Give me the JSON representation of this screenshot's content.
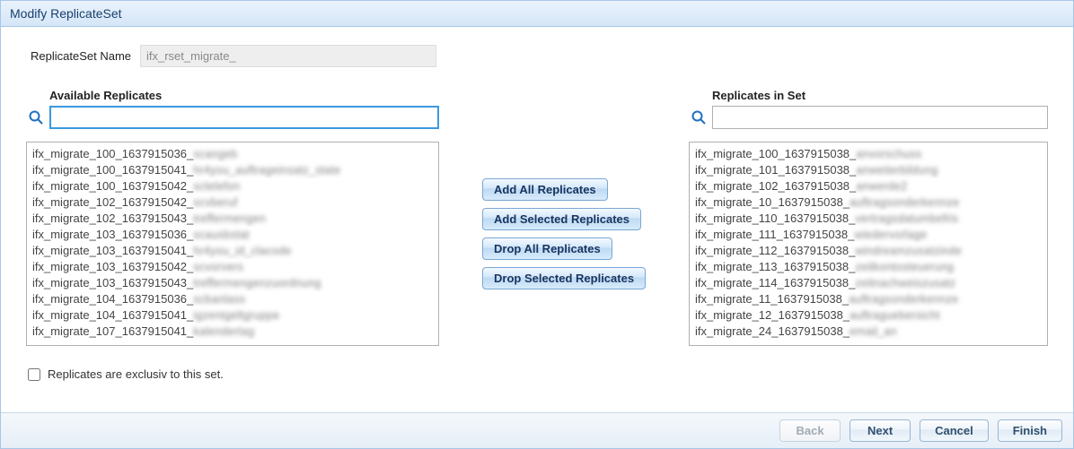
{
  "window": {
    "title": "Modify ReplicateSet"
  },
  "form": {
    "name_label": "ReplicateSet Name",
    "name_value": "ifx_rset_migrate_"
  },
  "left": {
    "title": "Available Replicates",
    "search": "",
    "items": [
      {
        "prefix": "ifx_migrate_100_1637915036_",
        "suffix": "scangeb"
      },
      {
        "prefix": "ifx_migrate_100_1637915041_",
        "suffix": "hr4you_auftrageinsatz_state"
      },
      {
        "prefix": "ifx_migrate_100_1637915042_",
        "suffix": "sctelefon"
      },
      {
        "prefix": "ifx_migrate_102_1637915042_",
        "suffix": "scvberuf"
      },
      {
        "prefix": "ifx_migrate_102_1637915043_",
        "suffix": "treffermengen"
      },
      {
        "prefix": "ifx_migrate_103_1637915036_",
        "suffix": "scausbstat"
      },
      {
        "prefix": "ifx_migrate_103_1637915041_",
        "suffix": "hr4you_id_clacode"
      },
      {
        "prefix": "ifx_migrate_103_1637915042_",
        "suffix": "scvorvers"
      },
      {
        "prefix": "ifx_migrate_103_1637915043_",
        "suffix": "treffermengenzuordnung"
      },
      {
        "prefix": "ifx_migrate_104_1637915036_",
        "suffix": "scbanlass"
      },
      {
        "prefix": "ifx_migrate_104_1637915041_",
        "suffix": "igzentgeltgruppe"
      },
      {
        "prefix": "ifx_migrate_107_1637915041_",
        "suffix": "kalendertag"
      }
    ]
  },
  "right": {
    "title": "Replicates in Set",
    "search": "",
    "items": [
      {
        "prefix": "ifx_migrate_100_1637915038_",
        "suffix": "anvorschuss"
      },
      {
        "prefix": "ifx_migrate_101_1637915038_",
        "suffix": "anweiterbildung"
      },
      {
        "prefix": "ifx_migrate_102_1637915038_",
        "suffix": "anwerde2"
      },
      {
        "prefix": "ifx_migrate_10_1637915038_",
        "suffix": "auftragsonderkennze"
      },
      {
        "prefix": "ifx_migrate_110_1637915038_",
        "suffix": "vertragsdatumbefris"
      },
      {
        "prefix": "ifx_migrate_111_1637915038_",
        "suffix": "wiedervorlage"
      },
      {
        "prefix": "ifx_migrate_112_1637915038_",
        "suffix": "windreamzusatzinde"
      },
      {
        "prefix": "ifx_migrate_113_1637915038_",
        "suffix": "zeitkontosteuerung"
      },
      {
        "prefix": "ifx_migrate_114_1637915038_",
        "suffix": "zeitnachweiszusatz"
      },
      {
        "prefix": "ifx_migrate_11_1637915038_",
        "suffix": "auftragsonderkennze"
      },
      {
        "prefix": "ifx_migrate_12_1637915038_",
        "suffix": "auftraguebersicht"
      },
      {
        "prefix": "ifx_migrate_24_1637915038_",
        "suffix": "email_an"
      }
    ]
  },
  "buttons": {
    "add_all": "Add All Replicates",
    "add_sel": "Add Selected Replicates",
    "drop_all": "Drop All Replicates",
    "drop_sel": "Drop Selected Replicates"
  },
  "exclusive": {
    "label": "Replicates are exclusiv to this set.",
    "checked": false
  },
  "footer": {
    "back": "Back",
    "next": "Next",
    "cancel": "Cancel",
    "finish": "Finish"
  }
}
